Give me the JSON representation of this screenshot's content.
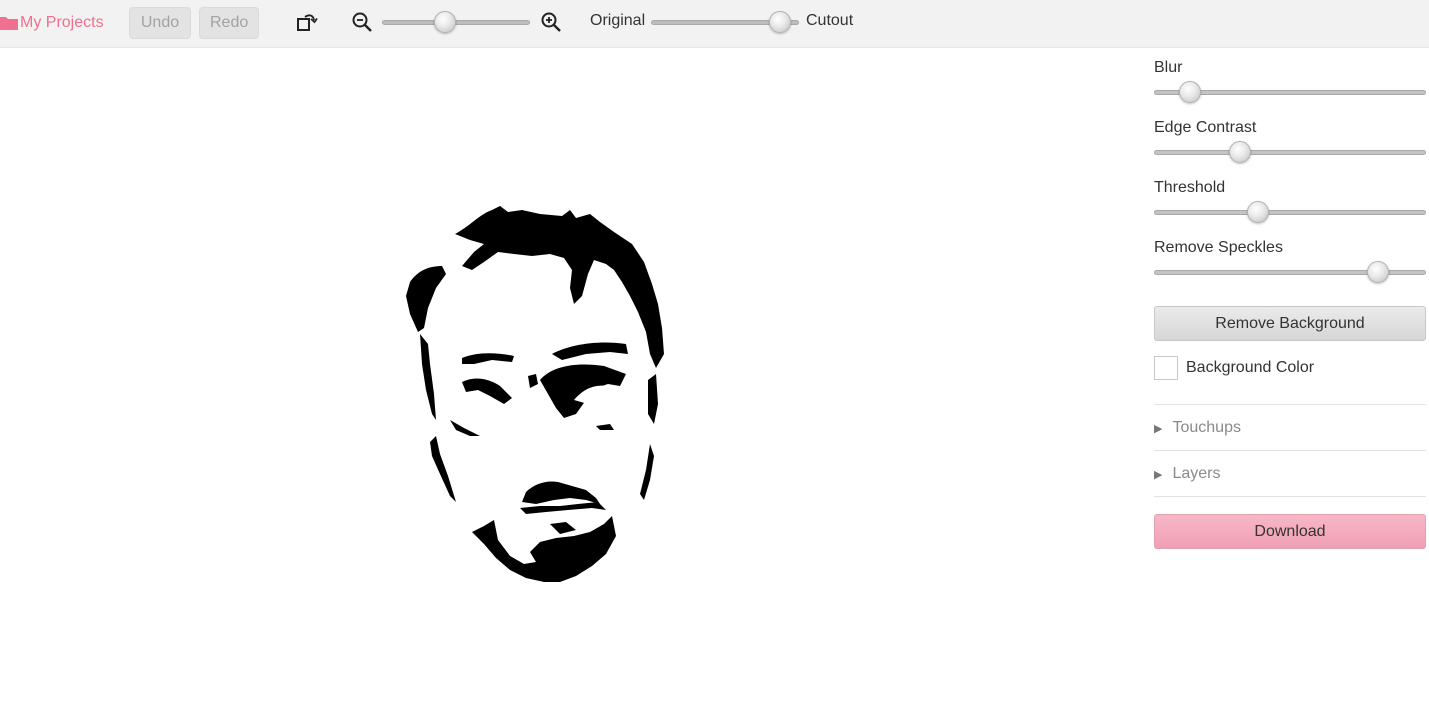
{
  "toolbar": {
    "projects_label": "My Projects",
    "undo_label": "Undo",
    "redo_label": "Redo",
    "zoom_level": 0.41,
    "original_label": "Original",
    "cutout_label": "Cutout",
    "view_mix": 0.94
  },
  "panel": {
    "blur": {
      "label": "Blur",
      "value": 0.1
    },
    "edge_contrast": {
      "label": "Edge Contrast",
      "value": 0.3
    },
    "threshold": {
      "label": "Threshold",
      "value": 0.37
    },
    "remove_speckles": {
      "label": "Remove Speckles",
      "value": 0.85
    },
    "remove_background_label": "Remove Background",
    "background_color_label": "Background Color",
    "background_color": "#ffffff",
    "touchups_label": "Touchups",
    "layers_label": "Layers",
    "download_label": "Download"
  },
  "colors": {
    "accent": "#f0708f",
    "download": "#f3a9bb"
  }
}
